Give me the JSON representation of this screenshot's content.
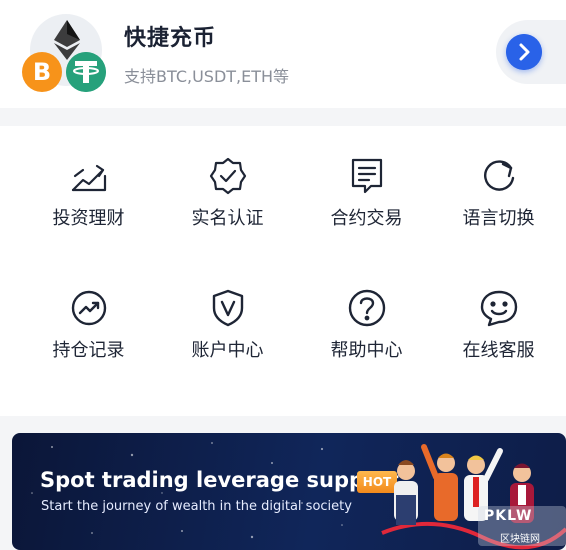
{
  "quick_deposit": {
    "title": "快捷充币",
    "subtitle": "支持BTC,USDT,ETH等",
    "btc_symbol": "B"
  },
  "menu": [
    {
      "label": "投资理财",
      "icon": "chart-trend-icon"
    },
    {
      "label": "实名认证",
      "icon": "verified-badge-icon"
    },
    {
      "label": "合约交易",
      "icon": "contract-doc-icon"
    },
    {
      "label": "语言切换",
      "icon": "refresh-icon"
    },
    {
      "label": "持仓记录",
      "icon": "trend-circle-icon"
    },
    {
      "label": "账户中心",
      "icon": "shield-v-icon"
    },
    {
      "label": "帮助中心",
      "icon": "help-circle-icon"
    },
    {
      "label": "在线客服",
      "icon": "smiley-chat-icon"
    }
  ],
  "banner": {
    "title": "Spot trading leverage support",
    "badge": "HOT",
    "subtitle": "Start the journey of wealth in the digital society"
  },
  "watermark": {
    "text": "PKLW",
    "sub": "区块链网"
  },
  "colors": {
    "accent": "#2962e8",
    "btc": "#f7931a",
    "usdt": "#26a17b",
    "banner_bg": "#0b1638"
  }
}
